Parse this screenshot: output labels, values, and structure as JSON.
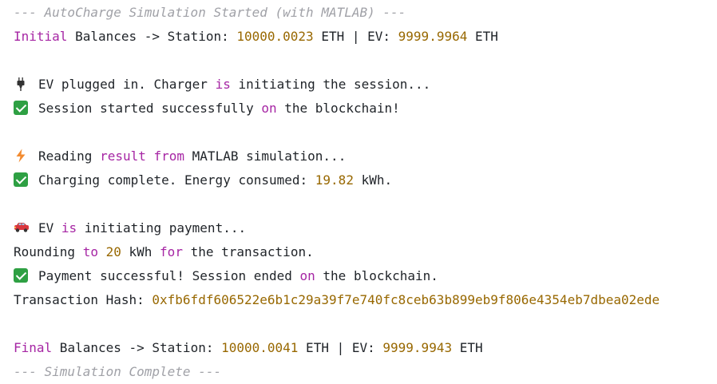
{
  "header_comment": "--- AutoCharge Simulation Started (with MATLAB) ---",
  "initial": {
    "kw": "Initial",
    "text_a": " Balances -> Station: ",
    "station": "10000.0023",
    "text_b": " ETH | EV: ",
    "ev": "9999.9964",
    "text_c": " ETH"
  },
  "plug": {
    "icon": "plug-icon",
    "a": "EV plugged in. Charger ",
    "kw": "is",
    "b": " initiating the session..."
  },
  "started": {
    "icon": "check-icon",
    "a": "Session started successfully ",
    "kw": "on",
    "b": " the blockchain!"
  },
  "reading": {
    "icon": "lightning-icon",
    "a": "Reading ",
    "kw1": "result",
    "sp": " ",
    "kw2": "from",
    "b": " MATLAB simulation..."
  },
  "complete": {
    "icon": "check-icon",
    "a": "Charging complete. Energy consumed: ",
    "num": "19.82",
    "b": " kWh."
  },
  "payment": {
    "icon": "car-icon",
    "a": "EV ",
    "kw": "is",
    "b": " initiating payment..."
  },
  "rounding": {
    "a": "Rounding ",
    "kw1": "to",
    "sp": " ",
    "num": "20",
    "b": " kWh ",
    "kw2": "for",
    "c": " the transaction."
  },
  "success": {
    "icon": "check-icon",
    "a": "Payment successful! Session ended ",
    "kw": "on",
    "b": " the blockchain."
  },
  "tx": {
    "label": "Transaction Hash: ",
    "hash": "0xfb6fdf606522e6b1c29a39f7e740fc8ceb63b899eb9f806e4354eb7dbea02ede"
  },
  "final": {
    "kw": "Final",
    "text_a": " Balances -> Station: ",
    "station": "10000.0041",
    "text_b": " ETH | EV: ",
    "ev": "9999.9943",
    "text_c": " ETH"
  },
  "footer_comment": "--- Simulation Complete ---",
  "colors": {
    "keyword": "#a626a4",
    "number": "#986801",
    "comment": "#a0a1a7",
    "check": "#2ea043"
  }
}
